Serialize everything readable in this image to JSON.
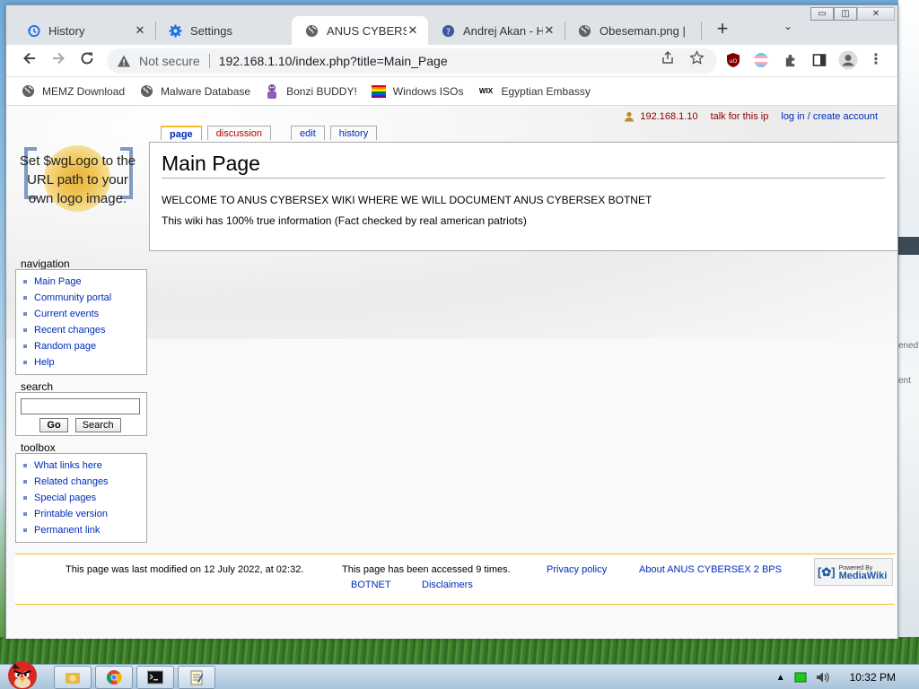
{
  "browser": {
    "tabs": [
      {
        "label": "History",
        "icon": "history-icon",
        "active": false
      },
      {
        "label": "Settings",
        "icon": "gear-icon",
        "active": false
      },
      {
        "label": "ANUS CYBERSEX",
        "icon": "globe-icon",
        "active": true
      },
      {
        "label": "Andrej Akan - H",
        "icon": "wiki-icon",
        "active": false
      },
      {
        "label": "Obeseman.png |",
        "icon": "globe-icon",
        "active": false
      }
    ],
    "new_tab": "+",
    "tab_menu": "⌄",
    "window_controls": [
      "▭",
      "◫",
      "✕"
    ],
    "security_label": "Not secure",
    "url": "192.168.1.10/index.php?title=Main_Page",
    "bookmarks": [
      {
        "label": "MEMZ Download",
        "icon": "globe-icon"
      },
      {
        "label": "Malware Database",
        "icon": "globe-icon"
      },
      {
        "label": "Bonzi BUDDY!",
        "icon": "bonzi-icon"
      },
      {
        "label": "Windows ISOs",
        "icon": "rainbow-flag-icon"
      },
      {
        "label": "Egyptian Embassy",
        "icon": "wix-icon"
      }
    ],
    "wix_text": "WIX"
  },
  "wiki": {
    "personal": {
      "ip": "192.168.1.10",
      "talk": "talk for this ip",
      "login": "log in / create account"
    },
    "page_tabs": [
      "page",
      "discussion",
      "edit",
      "history"
    ],
    "logo_text": "Set $wgLogo to the URL path to your own logo image.",
    "title": "Main Page",
    "paragraphs": [
      "WELCOME TO ANUS CYBERSEX WIKI WHERE WE WILL DOCUMENT ANUS CYBERSEX BOTNET",
      "This wiki has 100% true information (Fact checked by real american patriots)"
    ],
    "navigation": {
      "heading": "navigation",
      "items": [
        "Main Page",
        "Community portal",
        "Current events",
        "Recent changes",
        "Random page",
        "Help"
      ]
    },
    "search": {
      "heading": "search",
      "go": "Go",
      "search": "Search"
    },
    "toolbox": {
      "heading": "toolbox",
      "items": [
        "What links here",
        "Related changes",
        "Special pages",
        "Printable version",
        "Permanent link"
      ]
    },
    "footer": {
      "modified": "This page was last modified on 12 July 2022, at 02:32.",
      "accessed": "This page has been accessed 9 times.",
      "privacy": "Privacy policy",
      "about_1": "About ANUS CYBERSEX 2 BPS",
      "about_2": "BOTNET",
      "disclaimers": "Disclaimers",
      "badge_small": "Powered By",
      "badge_big": "MediaWiki"
    }
  },
  "desktop": {
    "ghost_text": [
      "ened",
      "ent"
    ]
  },
  "taskbar": {
    "clock": "10:32 PM"
  },
  "colors": {
    "link": "#002bb8",
    "new_link": "#ba0000",
    "accent": "#fabd23"
  }
}
